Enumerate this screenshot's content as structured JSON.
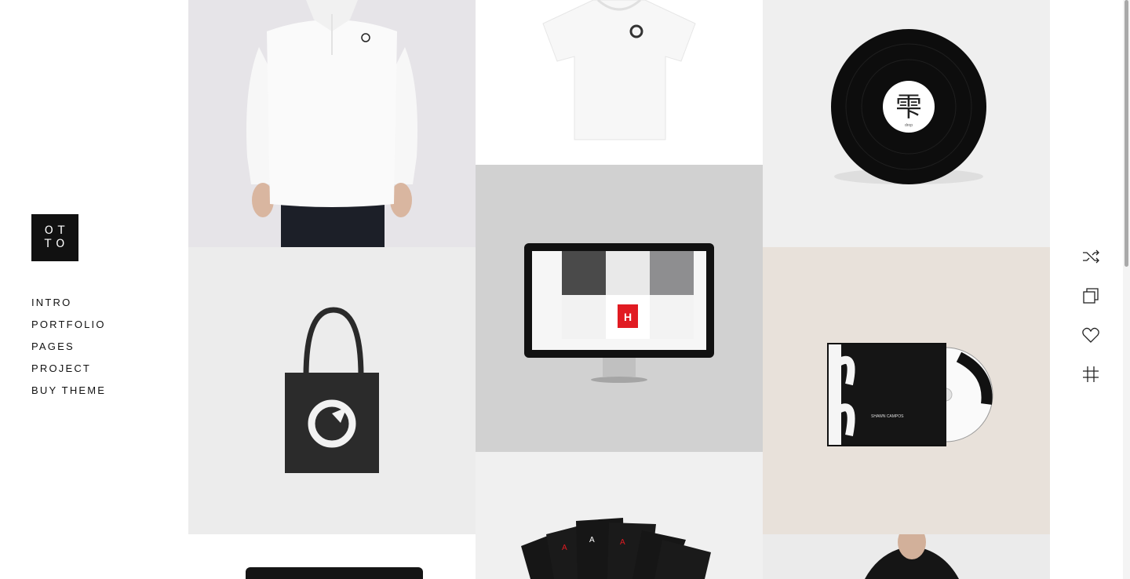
{
  "brand": {
    "logo_line1": "OT",
    "logo_line2": "TO"
  },
  "nav": {
    "items": [
      {
        "label": "INTRO"
      },
      {
        "label": "PORTFOLIO"
      },
      {
        "label": "PAGES"
      },
      {
        "label": "PROJECT"
      },
      {
        "label": "BUY THEME"
      }
    ]
  },
  "portfolio": {
    "items": [
      {
        "name": "polo-shirt",
        "bg": "#e6e4e8"
      },
      {
        "name": "tshirt",
        "bg": "#ffffff"
      },
      {
        "name": "vinyl-record",
        "bg": "#efefef",
        "label_char": "雫",
        "label_sub": "drop"
      },
      {
        "name": "tote-bag",
        "bg": "#ececec"
      },
      {
        "name": "monitor",
        "bg": "#d1d1d1",
        "screen_badge": "H"
      },
      {
        "name": "cd-case",
        "bg": "#e8e1da",
        "cd_text": "SHAWN CAMPOS"
      },
      {
        "name": "business-card",
        "bg": "#ffffff"
      },
      {
        "name": "playing-cards",
        "bg": "#f0f0f0"
      },
      {
        "name": "hoodie-model",
        "bg": "#ebebeb"
      }
    ]
  },
  "right_toolbar": {
    "icons": [
      "shuffle-icon",
      "copy-icon",
      "heart-icon",
      "hashtag-icon"
    ]
  },
  "colors": {
    "accent": "#111111",
    "cards_red": "#e11b22"
  }
}
